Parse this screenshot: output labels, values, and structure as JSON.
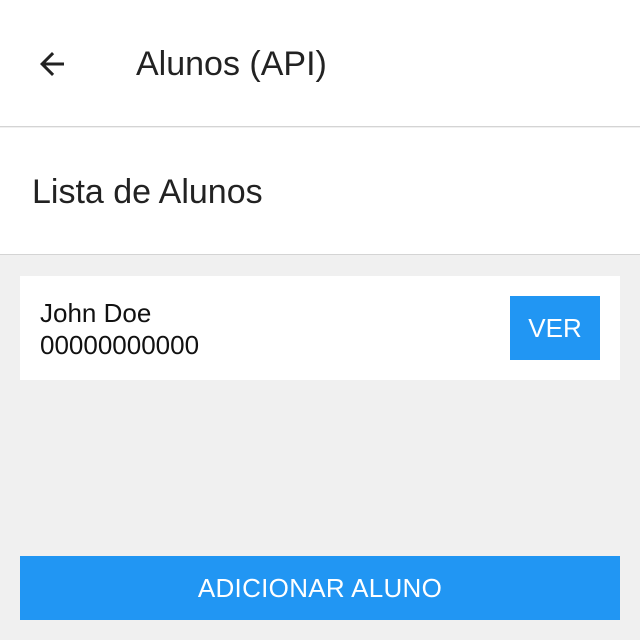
{
  "app_bar": {
    "back_icon": "arrow-left-icon",
    "title": "Alunos (API)"
  },
  "list_header": {
    "title": "Lista de Alunos"
  },
  "students": [
    {
      "name": "John Doe",
      "id": "00000000000",
      "view_label": "VER"
    }
  ],
  "actions": {
    "add_label": "ADICIONAR ALUNO"
  },
  "colors": {
    "accent": "#2196f3",
    "background": "#f0f0f0",
    "surface": "#ffffff"
  }
}
